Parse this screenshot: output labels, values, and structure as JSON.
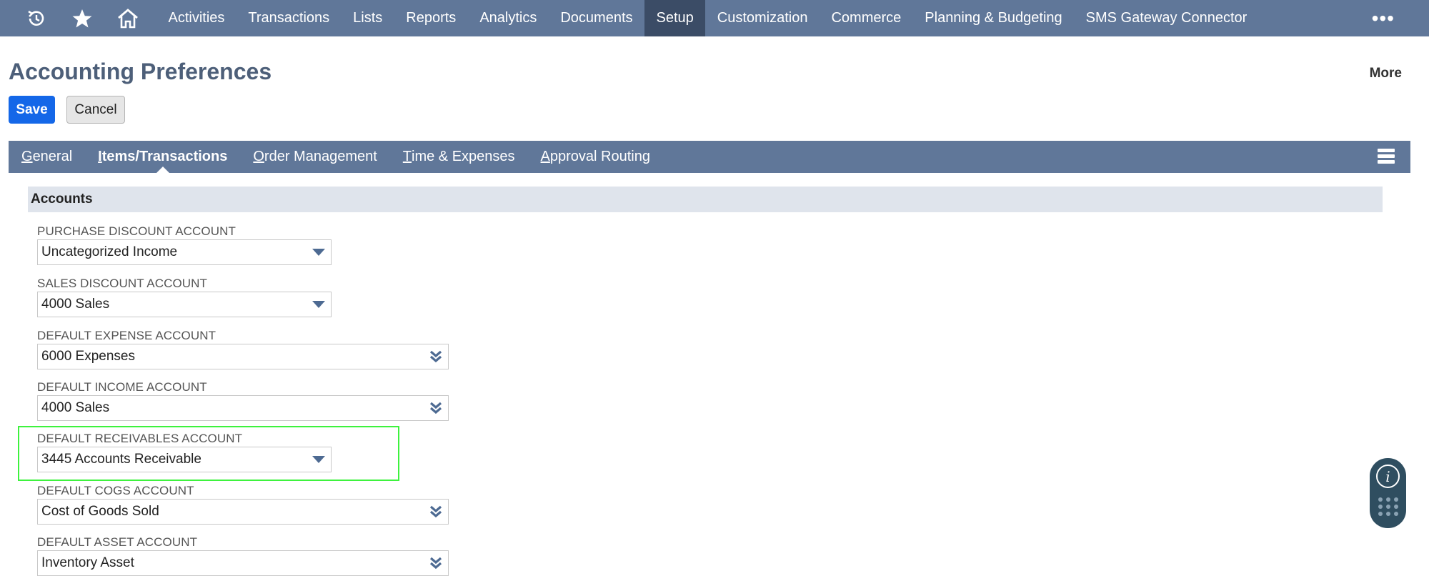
{
  "topnav": {
    "icons": [
      "recent-icon",
      "star-icon",
      "home-icon"
    ],
    "items": [
      {
        "label": "Activities"
      },
      {
        "label": "Transactions"
      },
      {
        "label": "Lists"
      },
      {
        "label": "Reports"
      },
      {
        "label": "Analytics"
      },
      {
        "label": "Documents"
      },
      {
        "label": "Setup",
        "active": true
      },
      {
        "label": "Customization"
      },
      {
        "label": "Commerce"
      },
      {
        "label": "Planning & Budgeting"
      },
      {
        "label": "SMS Gateway Connector"
      }
    ],
    "more_label": "•••"
  },
  "page": {
    "title": "Accounting Preferences",
    "more_label": "More",
    "save_label": "Save",
    "cancel_label": "Cancel"
  },
  "tabs": [
    {
      "first": "G",
      "rest": "eneral"
    },
    {
      "first": "I",
      "rest": "tems/Transactions",
      "active": true
    },
    {
      "first": "O",
      "rest": "rder Management"
    },
    {
      "first": "T",
      "rest": "ime & Expenses"
    },
    {
      "first": "A",
      "rest": "pproval Routing"
    }
  ],
  "section": {
    "title": "Accounts",
    "fields": [
      {
        "label": "Purchase Discount Account",
        "value": "Uncategorized Income"
      },
      {
        "label": "Sales Discount Account",
        "value": "4000 Sales"
      },
      {
        "label": "Default Expense Account",
        "value": "6000 Expenses"
      },
      {
        "label": "Default Income Account",
        "value": "4000 Sales"
      },
      {
        "label": "Default Receivables Account",
        "value": "3445 Accounts Receivable"
      },
      {
        "label": "Default COGS Account",
        "value": "Cost of Goods Sold"
      },
      {
        "label": "Default Asset Account",
        "value": "Inventory Asset"
      }
    ]
  },
  "colors": {
    "nav_bg": "#607799",
    "nav_active": "#3b4c66",
    "save_blue": "#1467e8",
    "highlight": "#3ef23e"
  },
  "widget": {
    "info_glyph": "i"
  }
}
